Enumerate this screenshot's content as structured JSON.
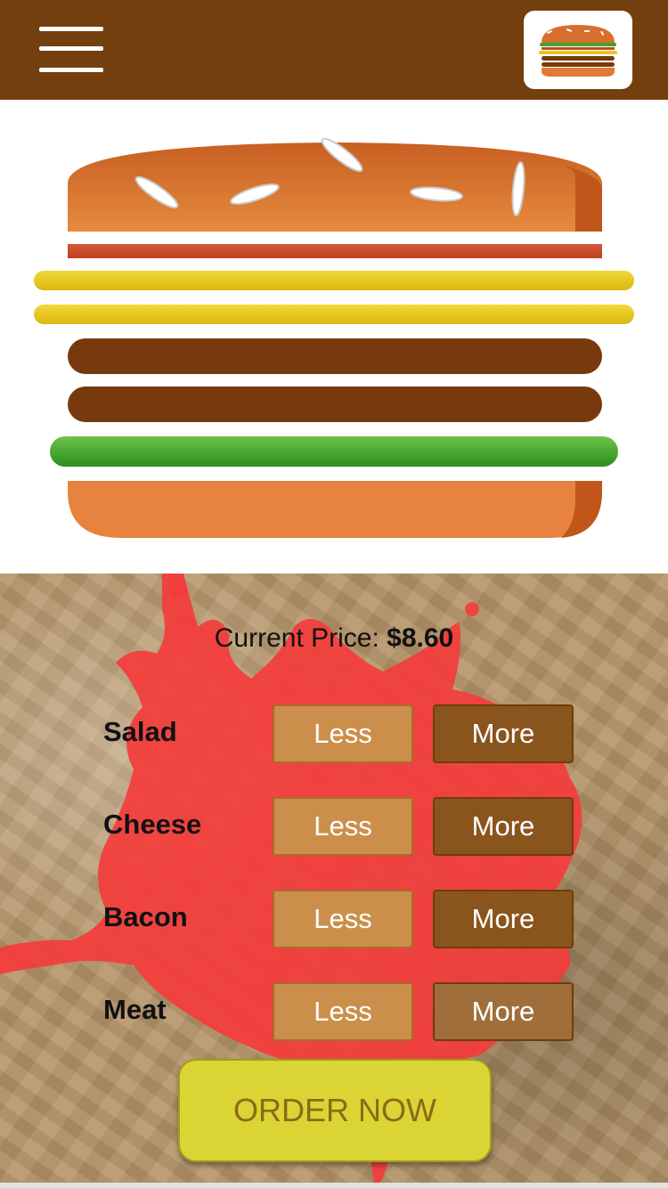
{
  "header": {
    "menu_icon": "hamburger-menu-icon",
    "logo_icon": "burger-logo-icon",
    "background": "#743f0e"
  },
  "price": {
    "label": "Current Price:",
    "value": "$8.60"
  },
  "ingredients": [
    {
      "label": "Salad",
      "less": "Less",
      "more": "More"
    },
    {
      "label": "Cheese",
      "less": "Less",
      "more": "More"
    },
    {
      "label": "Bacon",
      "less": "Less",
      "more": "More"
    },
    {
      "label": "Meat",
      "less": "Less",
      "more": "More"
    }
  ],
  "order": {
    "label": "ORDER NOW"
  },
  "colors": {
    "bun": "#e07a36",
    "bacon": "#c64a2a",
    "cheese": "#e6c81a",
    "meat": "#7a3a0c",
    "salad": "#3da429",
    "less_button": "#cb8f4b",
    "more_button": "#8a551d",
    "order_button": "#dad535",
    "splash": "#f43c3c"
  }
}
